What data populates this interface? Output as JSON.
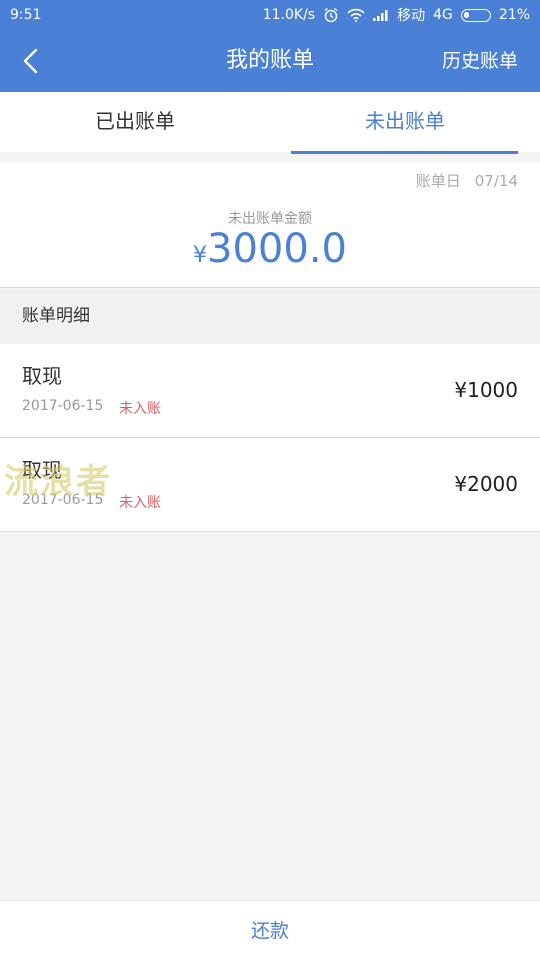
{
  "status_bar": {
    "time": "9:51",
    "speed": "11.0K/s",
    "carrier": "移动",
    "network": "4G",
    "battery": "21%",
    "battery_level": 0.21,
    "icons": [
      "alarm-icon",
      "wifi-icon",
      "signal-icon",
      "battery-icon"
    ]
  },
  "nav": {
    "back_icon": "chevron-left-icon",
    "title": "我的账单",
    "right_label": "历史账单"
  },
  "tabs": [
    {
      "label": "已出账单",
      "active": false
    },
    {
      "label": "未出账单",
      "active": true
    }
  ],
  "summary": {
    "bill_day_label": "账单日",
    "bill_day_value": "07/14",
    "unbilled_label": "未出账单金额",
    "currency": "¥",
    "amount": "3000.0"
  },
  "detail": {
    "header": "账单明细",
    "items": [
      {
        "title": "取现",
        "date": "2017-06-15",
        "status": "未入账",
        "amount": "¥1000"
      },
      {
        "title": "取现",
        "date": "2017-06-15",
        "status": "未入账",
        "amount": "¥2000"
      }
    ]
  },
  "watermark": "流浪者",
  "footer": {
    "repay_label": "还款"
  },
  "colors": {
    "accent": "#4a80d6",
    "status_tag": "#e06060"
  }
}
